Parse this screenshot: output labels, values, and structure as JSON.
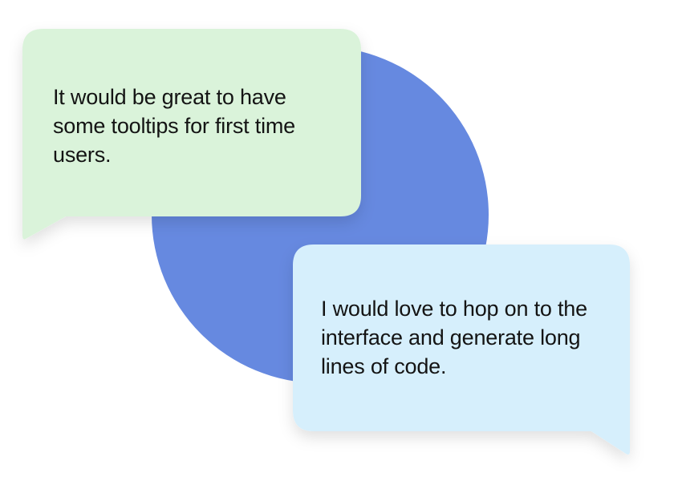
{
  "colors": {
    "circle": "#6689E0",
    "bubble_green": "#DAF3DA",
    "bubble_blue": "#D6EFFC",
    "text": "#141414"
  },
  "bubbles": [
    {
      "text": "It would be great to have some tooltips for first time users.",
      "tail": "bottom-left"
    },
    {
      "text": "I would love to hop on to the interface and generate long lines of code.",
      "tail": "bottom-right"
    }
  ]
}
